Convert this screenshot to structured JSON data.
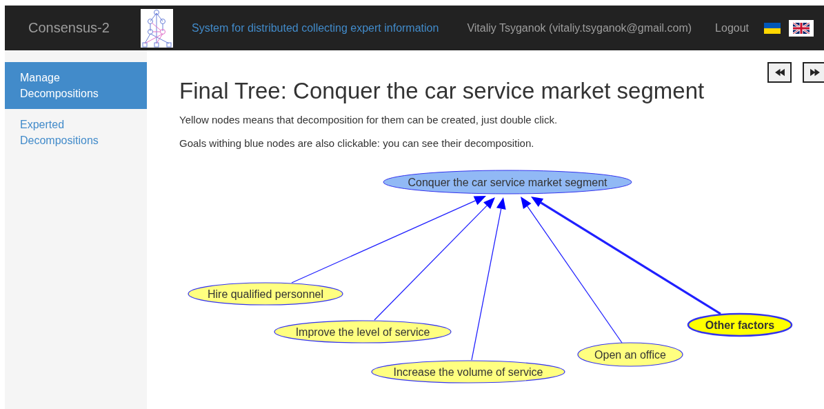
{
  "header": {
    "brand": "Consensus-2",
    "tagline": "System for distributed collecting expert information",
    "user": "Vitaliy Tsyganok (vitaliy.tsyganok@gmail.com)",
    "logout": "Logout",
    "languages": [
      {
        "kind": "ua",
        "selected": false
      },
      {
        "kind": "gb",
        "selected": true
      }
    ]
  },
  "sidebar": {
    "items": [
      {
        "label": "Manage Decompositions",
        "selected": true
      },
      {
        "label": "Experted Decompositions",
        "selected": false
      }
    ]
  },
  "page": {
    "title": "Final Tree: Conquer the car service market segment",
    "notes": [
      "Yellow nodes means that decomposition for them can be created, just double click.",
      "Goals withing blue nodes are also clickable: you can see their decomposition."
    ],
    "tree": {
      "root": {
        "label": "Conquer the car service market segment"
      },
      "children": [
        {
          "label": "Hire qualified personnel",
          "highlighted": false
        },
        {
          "label": "Improve the level of service",
          "highlighted": false
        },
        {
          "label": "Increase the volume of service",
          "highlighted": false
        },
        {
          "label": "Open an office",
          "highlighted": false
        },
        {
          "label": "Other factors",
          "highlighted": true
        }
      ]
    }
  }
}
